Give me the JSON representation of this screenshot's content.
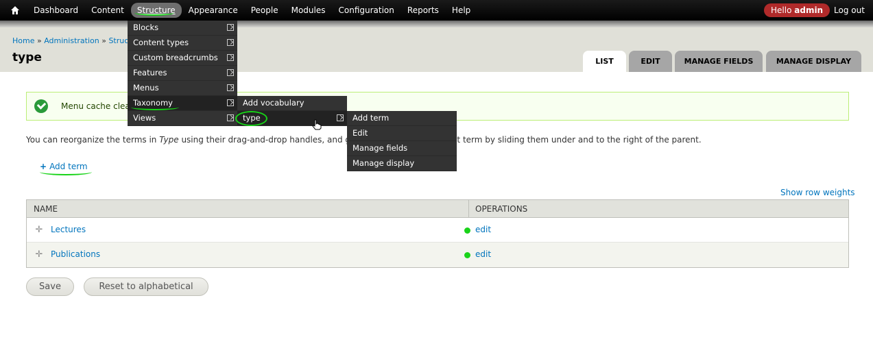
{
  "toolbar": {
    "home_icon": "home-icon",
    "menu": [
      "Dashboard",
      "Content",
      "Structure",
      "Appearance",
      "People",
      "Modules",
      "Configuration",
      "Reports",
      "Help"
    ],
    "active_index": 2,
    "hello_prefix": "Hello",
    "hello_user": "admin",
    "logout": "Log out"
  },
  "breadcrumb": [
    "Home",
    "Administration",
    "Structure"
  ],
  "breadcrumb_separator": "»",
  "page_title": "type",
  "tabs": [
    "LIST",
    "EDIT",
    "MANAGE FIELDS",
    "MANAGE DISPLAY"
  ],
  "active_tab": "LIST",
  "message": "Menu cache clea",
  "help_text": {
    "before": "You can reorganize the terms in ",
    "em": "Type",
    "middle": " using their drag-and-drop handles, and group te",
    "after": "rms under a parent term by sliding them under and to the right of the parent."
  },
  "add_term": "Add term",
  "show_row_weights": "Show row weights",
  "table": {
    "headers": [
      "NAME",
      "OPERATIONS"
    ],
    "rows": [
      {
        "name": "Lectures",
        "op": "edit"
      },
      {
        "name": "Publications",
        "op": "edit"
      }
    ]
  },
  "buttons": {
    "save": "Save",
    "reset": "Reset to alphabetical"
  },
  "structure_menu": [
    "Blocks",
    "Content types",
    "Custom breadcrumbs",
    "Features",
    "Menus",
    "Taxonomy",
    "Views"
  ],
  "taxonomy_menu": [
    "Add vocabulary",
    "type"
  ],
  "type_menu": [
    "Add term",
    "Edit",
    "Manage fields",
    "Manage display"
  ],
  "colors": {
    "accent_link": "#0074bd",
    "annotation": "#17d317",
    "toolbar": "#000000",
    "hello_badge": "#b02a2a"
  }
}
